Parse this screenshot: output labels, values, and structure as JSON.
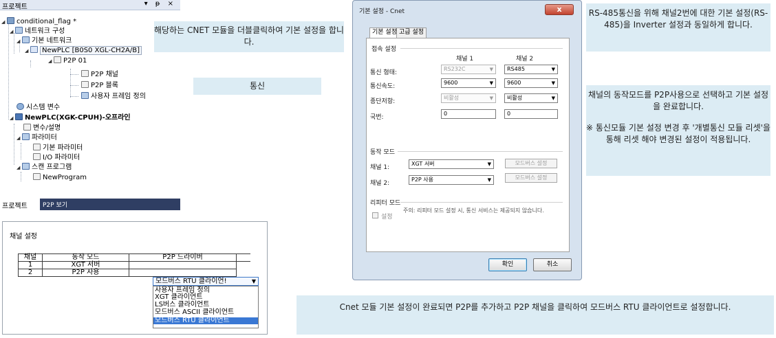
{
  "project_panel": {
    "header_title": "프로젝트",
    "header_controls": "▾ ᵽ ×",
    "tree": [
      {
        "label": "conditional_flag *",
        "bold": false
      },
      {
        "label": "네트워크 구성",
        "bold": false
      },
      {
        "label": "기본 네트워크",
        "bold": false
      },
      {
        "label": "NewPLC [B0S0 XGL-CH2A/B]",
        "bold": false
      },
      {
        "label": "P2P 01",
        "bold": false
      },
      {
        "label": "P2P 채널",
        "bold": false
      },
      {
        "label": "P2P 블록",
        "bold": false
      },
      {
        "label": "사용자 프레임 정의",
        "bold": false
      },
      {
        "label": "시스템 변수",
        "bold": false
      },
      {
        "label": "NewPLC(XGK-CPUH)-오프라인",
        "bold": true
      },
      {
        "label": "변수/설명",
        "bold": false
      },
      {
        "label": "파라미터",
        "bold": false
      },
      {
        "label": "기본 파라미터",
        "bold": false
      },
      {
        "label": "I/O 파라미터",
        "bold": false
      },
      {
        "label": "스캔 프로그램",
        "bold": false
      },
      {
        "label": "NewProgram",
        "bold": false
      }
    ],
    "tabs": [
      "프로젝트",
      "P2P 보기"
    ]
  },
  "channel_panel": {
    "title": "채널 설정",
    "columns": [
      "채널",
      "동작 모드",
      "P2P 드라이버"
    ],
    "rows": [
      {
        "channel": "1",
        "mode": "XGT 서버",
        "driver": ""
      },
      {
        "channel": "2",
        "mode": "P2P 사용",
        "driver": ""
      }
    ],
    "driver_selected": "모드버스 RTU 클라이언!",
    "driver_options": [
      "사용자 프레임 정의",
      "XGT 클라이언트",
      "LS버스 클라이언트",
      "모드버스 ASCII 클라이언트",
      "모드버스 RTU 클라이언트"
    ],
    "driver_selected_index": 4
  },
  "dialog": {
    "title": "기본 설정 - Cnet",
    "close_glyph": "x",
    "tabs": [
      "기본 설정",
      "고급 설정"
    ],
    "connection_group": "접속 설정",
    "channel1_header": "채널 1",
    "channel2_header": "채널 2",
    "fields": [
      {
        "label": "통신 형태:",
        "ch1": "RS232C",
        "ch1_disabled": true,
        "ch2": "RS485"
      },
      {
        "label": "통신속도:",
        "ch1": "9600",
        "ch1_disabled": false,
        "ch2": "9600"
      },
      {
        "label": "종단저항:",
        "ch1": "비활성",
        "ch1_disabled": true,
        "ch2": "비활성"
      },
      {
        "label": "국번:",
        "ch1": "0",
        "ch1_disabled": false,
        "ch2": "0"
      }
    ],
    "mode_group": "동작 모드",
    "channel1_mode_label": "채널 1:",
    "channel1_mode": "XGT 서버",
    "channel2_mode_label": "채널 2:",
    "channel2_mode": "P2P 사용",
    "modbus_btn": "모드버스 설정",
    "repeater_group": "리피터 모드",
    "repeater_checkbox_label": "설정",
    "repeater_note": "주의: 리피터 모드 설정 시, 통신 서비스는 제공되지 않습니다.",
    "ok": "확인",
    "cancel": "취소"
  },
  "callouts": {
    "dblclick": "해당하는 CNET  모듈을 더블클릭하여 기본 설정을 합니다.",
    "comm": "통신",
    "rs485": "RS-485통신을 위해 채널2번에 대한 기본 설정(RS-485)을 Inverter 설정과 동일하게 합니다.",
    "mode_line1": "채널의 동작모드를 P2P사용으로 선택하고 기본 설정을 완료합니다.",
    "mode_line2": "※ 통신모듈 기본 설정 변경 후 '개별통신 모듈 리셋'을 통해 리셋 해야 변경된 설정이 적용됩니다.",
    "p2p": "Cnet 모듈 기본 설정이 완료되면 P2P를 추가하고 P2P 채널을 클릭하여 모드버스 RTU 클라이언트로 설정합니다."
  }
}
